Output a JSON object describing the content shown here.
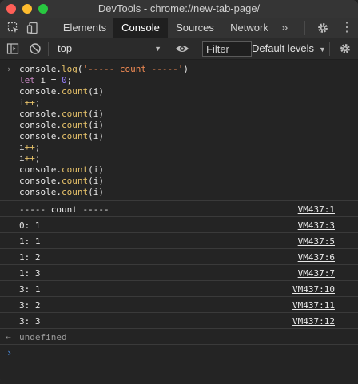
{
  "window": {
    "title": "DevTools - chrome://new-tab-page/"
  },
  "tabs": [
    {
      "label": "Elements",
      "active": false
    },
    {
      "label": "Console",
      "active": true
    },
    {
      "label": "Sources",
      "active": false
    },
    {
      "label": "Network",
      "active": false
    }
  ],
  "tabbar": {
    "more": "»",
    "menu": "⋮"
  },
  "console_toolbar": {
    "context": "top",
    "filter_placeholder": "Filter",
    "levels": "Default levels"
  },
  "console_input": [
    [
      {
        "t": "console.",
        "c": "ident"
      },
      {
        "t": "log",
        "c": "fn"
      },
      {
        "t": "(",
        "c": "op"
      },
      {
        "t": "'----- count -----'",
        "c": "str"
      },
      {
        "t": ")",
        "c": "op"
      }
    ],
    [
      {
        "t": "let",
        "c": "kw"
      },
      {
        "t": " i = ",
        "c": "op"
      },
      {
        "t": "0",
        "c": "num"
      },
      {
        "t": ";",
        "c": "op"
      }
    ],
    [
      {
        "t": "console.",
        "c": "ident"
      },
      {
        "t": "count",
        "c": "fn"
      },
      {
        "t": "(i)",
        "c": "op"
      }
    ],
    [
      {
        "t": "i",
        "c": "ident"
      },
      {
        "t": "++",
        "c": "fn"
      },
      {
        "t": ";",
        "c": "op"
      }
    ],
    [
      {
        "t": "console.",
        "c": "ident"
      },
      {
        "t": "count",
        "c": "fn"
      },
      {
        "t": "(i)",
        "c": "op"
      }
    ],
    [
      {
        "t": "console.",
        "c": "ident"
      },
      {
        "t": "count",
        "c": "fn"
      },
      {
        "t": "(i)",
        "c": "op"
      }
    ],
    [
      {
        "t": "console.",
        "c": "ident"
      },
      {
        "t": "count",
        "c": "fn"
      },
      {
        "t": "(i)",
        "c": "op"
      }
    ],
    [
      {
        "t": "i",
        "c": "ident"
      },
      {
        "t": "++",
        "c": "fn"
      },
      {
        "t": ";",
        "c": "op"
      }
    ],
    [
      {
        "t": "i",
        "c": "ident"
      },
      {
        "t": "++",
        "c": "fn"
      },
      {
        "t": ";",
        "c": "op"
      }
    ],
    [
      {
        "t": "console.",
        "c": "ident"
      },
      {
        "t": "count",
        "c": "fn"
      },
      {
        "t": "(i)",
        "c": "op"
      }
    ],
    [
      {
        "t": "console.",
        "c": "ident"
      },
      {
        "t": "count",
        "c": "fn"
      },
      {
        "t": "(i)",
        "c": "op"
      }
    ],
    [
      {
        "t": "console.",
        "c": "ident"
      },
      {
        "t": "count",
        "c": "fn"
      },
      {
        "t": "(i)",
        "c": "op"
      }
    ]
  ],
  "console_output": [
    {
      "message": "----- count -----",
      "source": "VM437:1"
    },
    {
      "message": "0: 1",
      "source": "VM437:3"
    },
    {
      "message": "1: 1",
      "source": "VM437:5"
    },
    {
      "message": "1: 2",
      "source": "VM437:6"
    },
    {
      "message": "1: 3",
      "source": "VM437:7"
    },
    {
      "message": "3: 1",
      "source": "VM437:10"
    },
    {
      "message": "3: 2",
      "source": "VM437:11"
    },
    {
      "message": "3: 3",
      "source": "VM437:12"
    }
  ],
  "result": {
    "arrow": "←",
    "value": "undefined"
  },
  "prompt": {
    "caret": "›",
    "input_arrow": "›"
  },
  "colors": {
    "string": "#f28b54",
    "keyword": "#c586c0",
    "number": "#9980ff",
    "function": "#e8c36a",
    "prompt": "#4e9cff"
  }
}
